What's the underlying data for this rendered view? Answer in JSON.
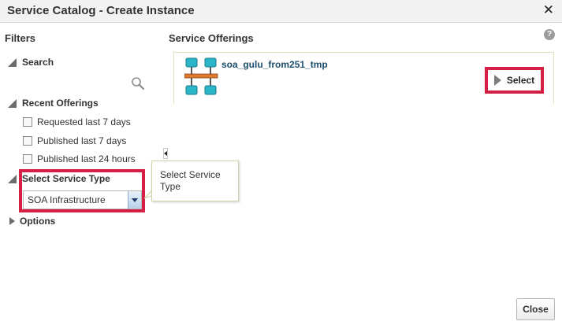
{
  "dialog": {
    "title": "Service Catalog - Create Instance",
    "close_glyph": "✕"
  },
  "filters": {
    "heading": "Filters",
    "search": {
      "label": "Search",
      "value": "",
      "icon": "magnifier-icon"
    },
    "recent_offerings": {
      "label": "Recent Offerings",
      "options": [
        {
          "label": "Requested last 7 days",
          "checked": false
        },
        {
          "label": "Published last 7 days",
          "checked": false
        },
        {
          "label": "Published last 24 hours",
          "checked": false
        }
      ]
    },
    "service_type": {
      "label": "Select Service Type",
      "selected": "SOA Infrastructure"
    },
    "options": {
      "label": "Options"
    }
  },
  "tooltip": {
    "text": "Select Service Type"
  },
  "offerings": {
    "heading": "Service Offerings",
    "help_glyph": "?",
    "items": [
      {
        "name": "soa_gulu_from251_tmp",
        "icon": "service-topology-icon",
        "action_label": "Select"
      }
    ]
  },
  "footer": {
    "close_label": "Close"
  },
  "colors": {
    "highlight": "#d51f45",
    "offering_name": "#1d4e6e",
    "icon_teal": "#2bb5c8",
    "icon_bar": "#e07a2e"
  }
}
